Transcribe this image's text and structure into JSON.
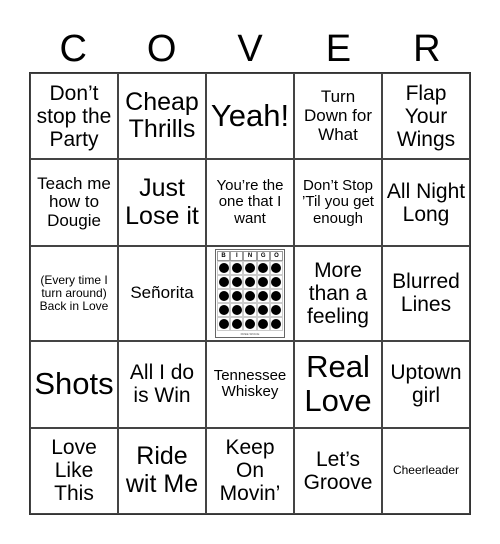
{
  "header": [
    "C",
    "O",
    "V",
    "E",
    "R"
  ],
  "free_space": {
    "label": "BINGO",
    "letters": [
      "B",
      "I",
      "N",
      "G",
      "O"
    ],
    "caption": "FREE SPACE"
  },
  "cells": [
    {
      "text": "Don’t stop the Party",
      "size": "m"
    },
    {
      "text": "Cheap Thrills",
      "size": "l"
    },
    {
      "text": "Yeah!",
      "size": "xl"
    },
    {
      "text": "Turn Down for What",
      "size": "s"
    },
    {
      "text": "Flap Your Wings",
      "size": "m"
    },
    {
      "text": "Teach me how to Dougie",
      "size": "s"
    },
    {
      "text": "Just Lose it",
      "size": "l"
    },
    {
      "text": "You’re the one that I want",
      "size": "xs"
    },
    {
      "text": "Don’t Stop ’Til you get enough",
      "size": "xs"
    },
    {
      "text": "All Night Long",
      "size": "m"
    },
    {
      "text": "(Every time I turn around) Back in Love",
      "size": "xxs"
    },
    {
      "text": "Señorita",
      "size": "s"
    },
    {
      "text": "FREE",
      "size": "free"
    },
    {
      "text": "More than a feeling",
      "size": "m"
    },
    {
      "text": "Blurred Lines",
      "size": "m"
    },
    {
      "text": "Shots",
      "size": "xl"
    },
    {
      "text": "All I do is Win",
      "size": "m"
    },
    {
      "text": "Tennessee Whiskey",
      "size": "xs"
    },
    {
      "text": "Real Love",
      "size": "xl"
    },
    {
      "text": "Uptown girl",
      "size": "m"
    },
    {
      "text": "Love Like This",
      "size": "m"
    },
    {
      "text": "Ride wit Me",
      "size": "l"
    },
    {
      "text": "Keep On Movin’",
      "size": "m"
    },
    {
      "text": "Let’s Groove",
      "size": "m"
    },
    {
      "text": "Cheerleader",
      "size": "xxs"
    }
  ]
}
